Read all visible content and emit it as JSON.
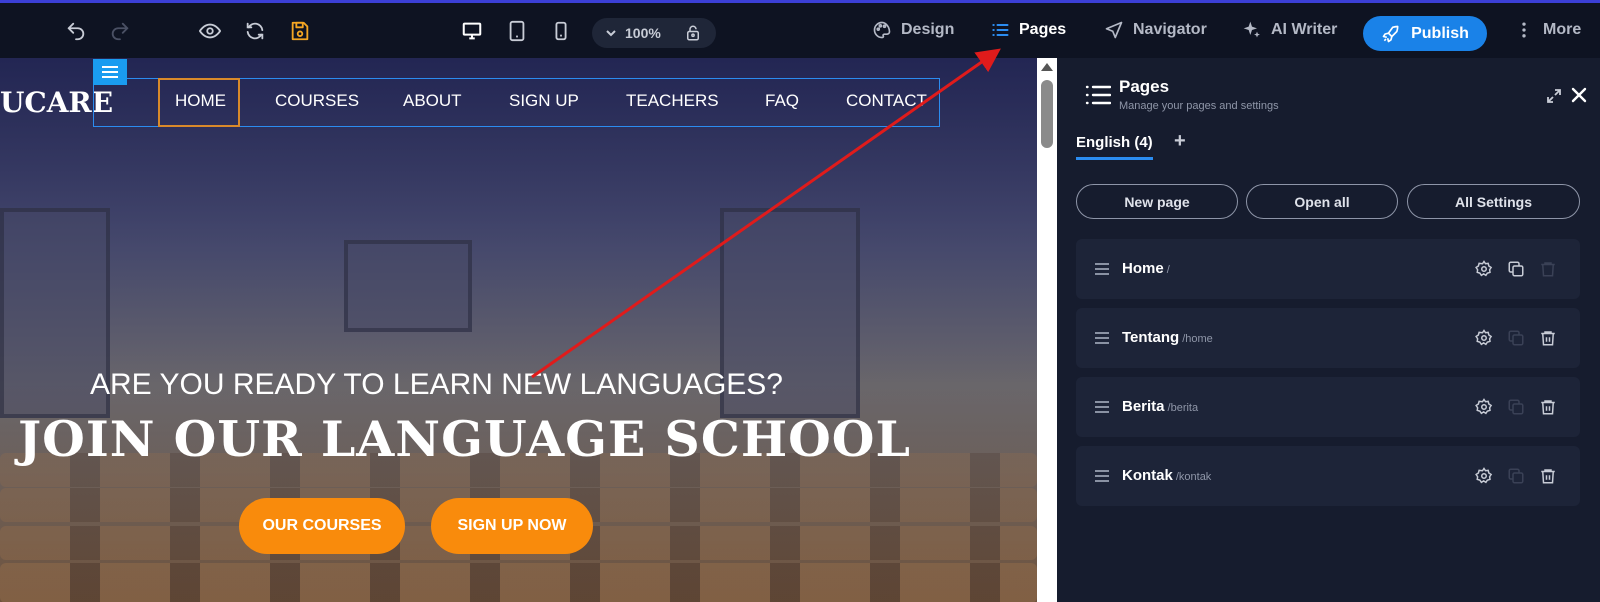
{
  "toolbar": {
    "undo_icon": "undo-icon",
    "redo_icon": "redo-icon",
    "preview_icon": "eye-icon",
    "refresh_icon": "refresh-icon",
    "save_icon": "save-icon",
    "devices": [
      "desktop-icon",
      "tablet-icon",
      "mobile-icon"
    ],
    "zoom": "100%",
    "nav": [
      {
        "label": "Design",
        "icon": "palette-icon"
      },
      {
        "label": "Pages",
        "icon": "list-icon",
        "active": true
      },
      {
        "label": "Navigator",
        "icon": "navigation-icon"
      },
      {
        "label": "AI Writer",
        "icon": "sparkle-icon"
      }
    ],
    "publish_label": "Publish",
    "more_label": "More"
  },
  "canvas": {
    "logo": "UCARE",
    "menu": [
      "HOME",
      "COURSES",
      "ABOUT",
      "SIGN UP",
      "TEACHERS",
      "FAQ",
      "CONTACT"
    ],
    "hero_subtitle": "ARE YOU READY TO LEARN NEW LANGUAGES?",
    "hero_title": "JOIN OUR LANGUAGE SCHOOL",
    "buttons": [
      "OUR COURSES",
      "SIGN UP NOW"
    ]
  },
  "panel": {
    "title": "Pages",
    "subtitle": "Manage your pages and settings",
    "language_tab": "English (4)",
    "add_language": "+",
    "actions": [
      "New page",
      "Open all",
      "All Settings"
    ],
    "pages": [
      {
        "name": "Home",
        "slug": "/",
        "delete_enabled": false,
        "duplicate_enabled": true
      },
      {
        "name": "Tentang",
        "slug": "/home",
        "delete_enabled": true,
        "duplicate_enabled": false
      },
      {
        "name": "Berita",
        "slug": "/berita",
        "delete_enabled": true,
        "duplicate_enabled": false
      },
      {
        "name": "Kontak",
        "slug": "/kontak",
        "delete_enabled": true,
        "duplicate_enabled": false
      }
    ]
  },
  "colors": {
    "accent": "#1a82e8",
    "hero_button": "#f98b0c",
    "save_icon": "#f5a623",
    "annotation_arrow": "#e01b1b"
  }
}
